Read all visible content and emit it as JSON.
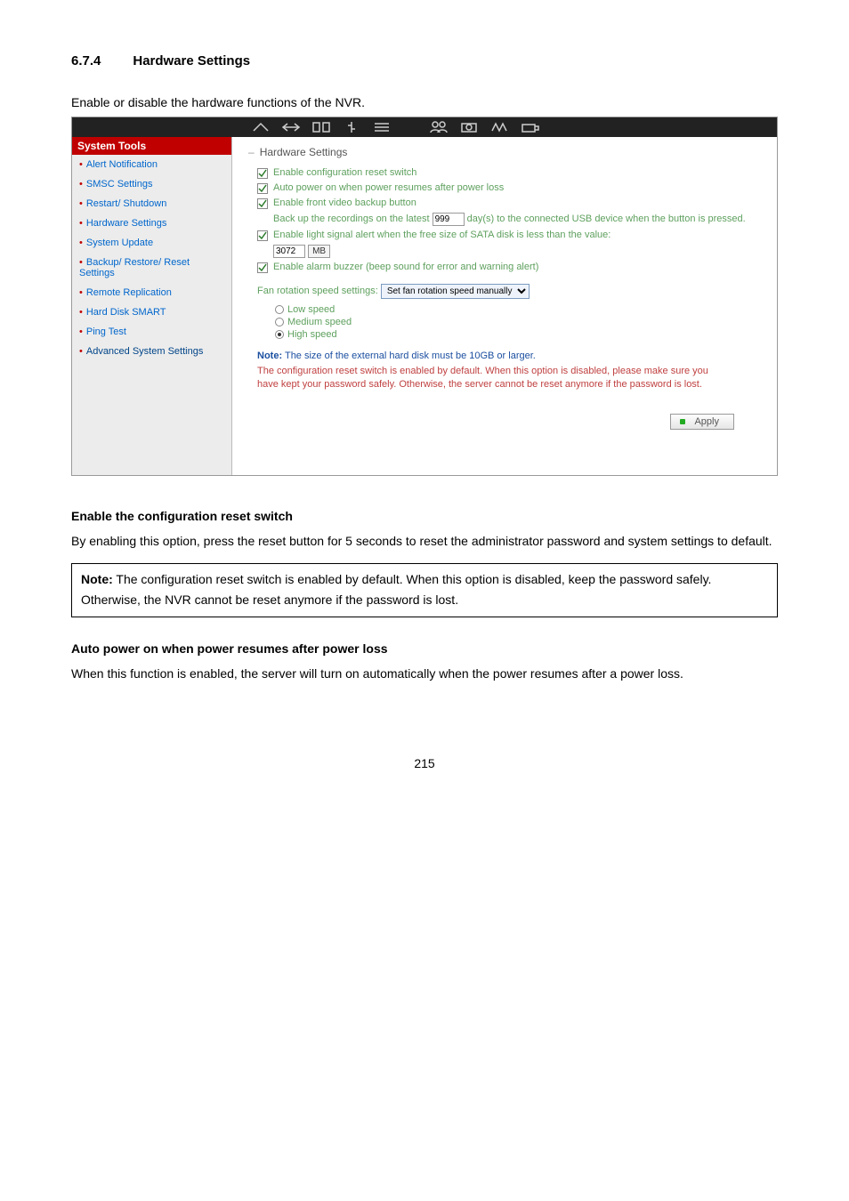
{
  "doc": {
    "section_number": "6.7.4",
    "section_title": "Hardware Settings",
    "intro": "Enable or disable the hardware functions of the NVR.",
    "page_number": "215"
  },
  "sidebar": {
    "header": "System Tools",
    "items": [
      {
        "label": "Alert Notification"
      },
      {
        "label": "SMSC Settings"
      },
      {
        "label": "Restart/ Shutdown"
      },
      {
        "label": "Hardware Settings"
      },
      {
        "label": "System Update"
      },
      {
        "label": "Backup/ Restore/ Reset Settings"
      },
      {
        "label": "Remote Replication"
      },
      {
        "label": "Hard Disk SMART"
      },
      {
        "label": "Ping Test"
      },
      {
        "label": "Advanced System Settings"
      }
    ]
  },
  "main": {
    "title": "Hardware Settings",
    "opts": {
      "reset_switch": "Enable configuration reset switch",
      "auto_power": "Auto power on when power resumes after power loss",
      "front_backup": "Enable front video backup button",
      "backup_days_pre": "Back up the recordings on the latest",
      "backup_days_val": "999",
      "backup_days_post": "day(s) to the connected USB device when the button is pressed.",
      "sata_alert": "Enable light signal alert when the free size of SATA disk is less than the value:",
      "sata_val": "3072",
      "sata_unit": "MB",
      "buzzer": "Enable alarm buzzer (beep sound for error and warning alert)"
    },
    "fan": {
      "label": "Fan rotation speed settings:",
      "select": "Set fan rotation speed manually",
      "low": "Low speed",
      "medium": "Medium speed",
      "high": "High speed"
    },
    "note_label": "Note:",
    "note_text": "The size of the external hard disk must be 10GB or larger.",
    "warn": "The configuration reset switch is enabled by default. When this option is disabled, please make sure you have kept your password safely. Otherwise, the server cannot be reset anymore if the password is lost.",
    "apply": "Apply"
  },
  "below": {
    "h1": "Enable the configuration reset switch",
    "p1": "By enabling this option, press the reset button for 5 seconds to reset the administrator password and system settings to default.",
    "note_label": "Note:",
    "note_text": "The configuration reset switch is enabled by default.   When this option is disabled, keep the password safely.   Otherwise, the NVR cannot be reset anymore if the password is lost.",
    "h2": "Auto power on when power resumes after power loss",
    "p2": "When this function is enabled, the server will turn on automatically when the power resumes after a power loss."
  }
}
